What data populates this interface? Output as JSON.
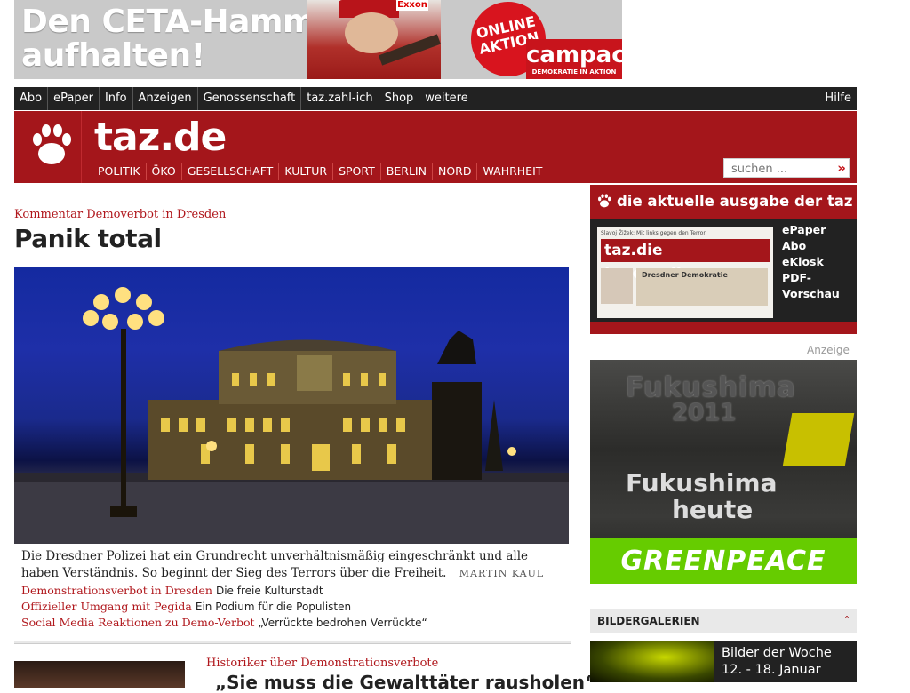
{
  "ad_banner": {
    "headline_line1": "Den CETA-Hammer",
    "headline_line2": "aufhalten!",
    "badge": "ONLINE AKTION",
    "brand": "campact",
    "brand_tagline": "DEMOKRATIE IN AKTION",
    "logo_exxon": "Exxon"
  },
  "topnav": {
    "items": [
      "Abo",
      "ePaper",
      "Info",
      "Anzeigen",
      "Genossenschaft",
      "taz.zahl-ich",
      "Shop",
      "weitere"
    ],
    "help": "Hilfe"
  },
  "header": {
    "logo": "taz.de",
    "nav": [
      "POLITIK",
      "ÖKO",
      "GESELLSCHAFT",
      "KULTUR",
      "SPORT",
      "BERLIN",
      "NORD",
      "WAHRHEIT"
    ],
    "search_placeholder": "suchen ...",
    "logo_icon": "paw-icon"
  },
  "main_article": {
    "kicker": "Kommentar Demoverbot in Dresden",
    "title": "Panik total",
    "teaser": "Die Dresdner Polizei hat ein Grundrecht unverhältnismäßig eingeschränkt und alle haben Verständnis. So beginnt der Sieg des Terrors über die Freiheit.",
    "author": "MARTIN KAUL",
    "related": [
      {
        "kicker": "Demonstrationsverbot in Dresden",
        "title": "Die freie Kulturstadt"
      },
      {
        "kicker": "Offizieller Umgang mit Pegida",
        "title": "Ein Podium für die Populisten"
      },
      {
        "kicker": "Social Media Reaktionen zu Demo-Verbot",
        "title": "„Verrückte bedrohen Verrückte“"
      }
    ]
  },
  "second_article": {
    "kicker": "Historiker über Demonstrationsverbote",
    "title": "„Sie muss die Gewalttäter rausholen“"
  },
  "sidebar": {
    "ausgabe_title": "die aktuelle ausgabe der taz",
    "paper_masthead": "taz.die tageszeitung",
    "paper_topline": "Slavoj Žižek: Mit links gegen den Terror",
    "paper_box": "Dresdner Demokratie",
    "links": [
      "ePaper",
      "Abo",
      "eKiosk",
      "PDF-",
      "Vorschau"
    ],
    "anzeige": "Anzeige",
    "ad": {
      "line1": "Fukushima",
      "line2": "2011",
      "line3": "Fukushima",
      "line4": "heute",
      "brand": "GREENPEACE"
    },
    "galleries_title": "BILDERGALERIEN",
    "gallery_caption": "Bilder der Woche 12. - 18. Januar"
  }
}
